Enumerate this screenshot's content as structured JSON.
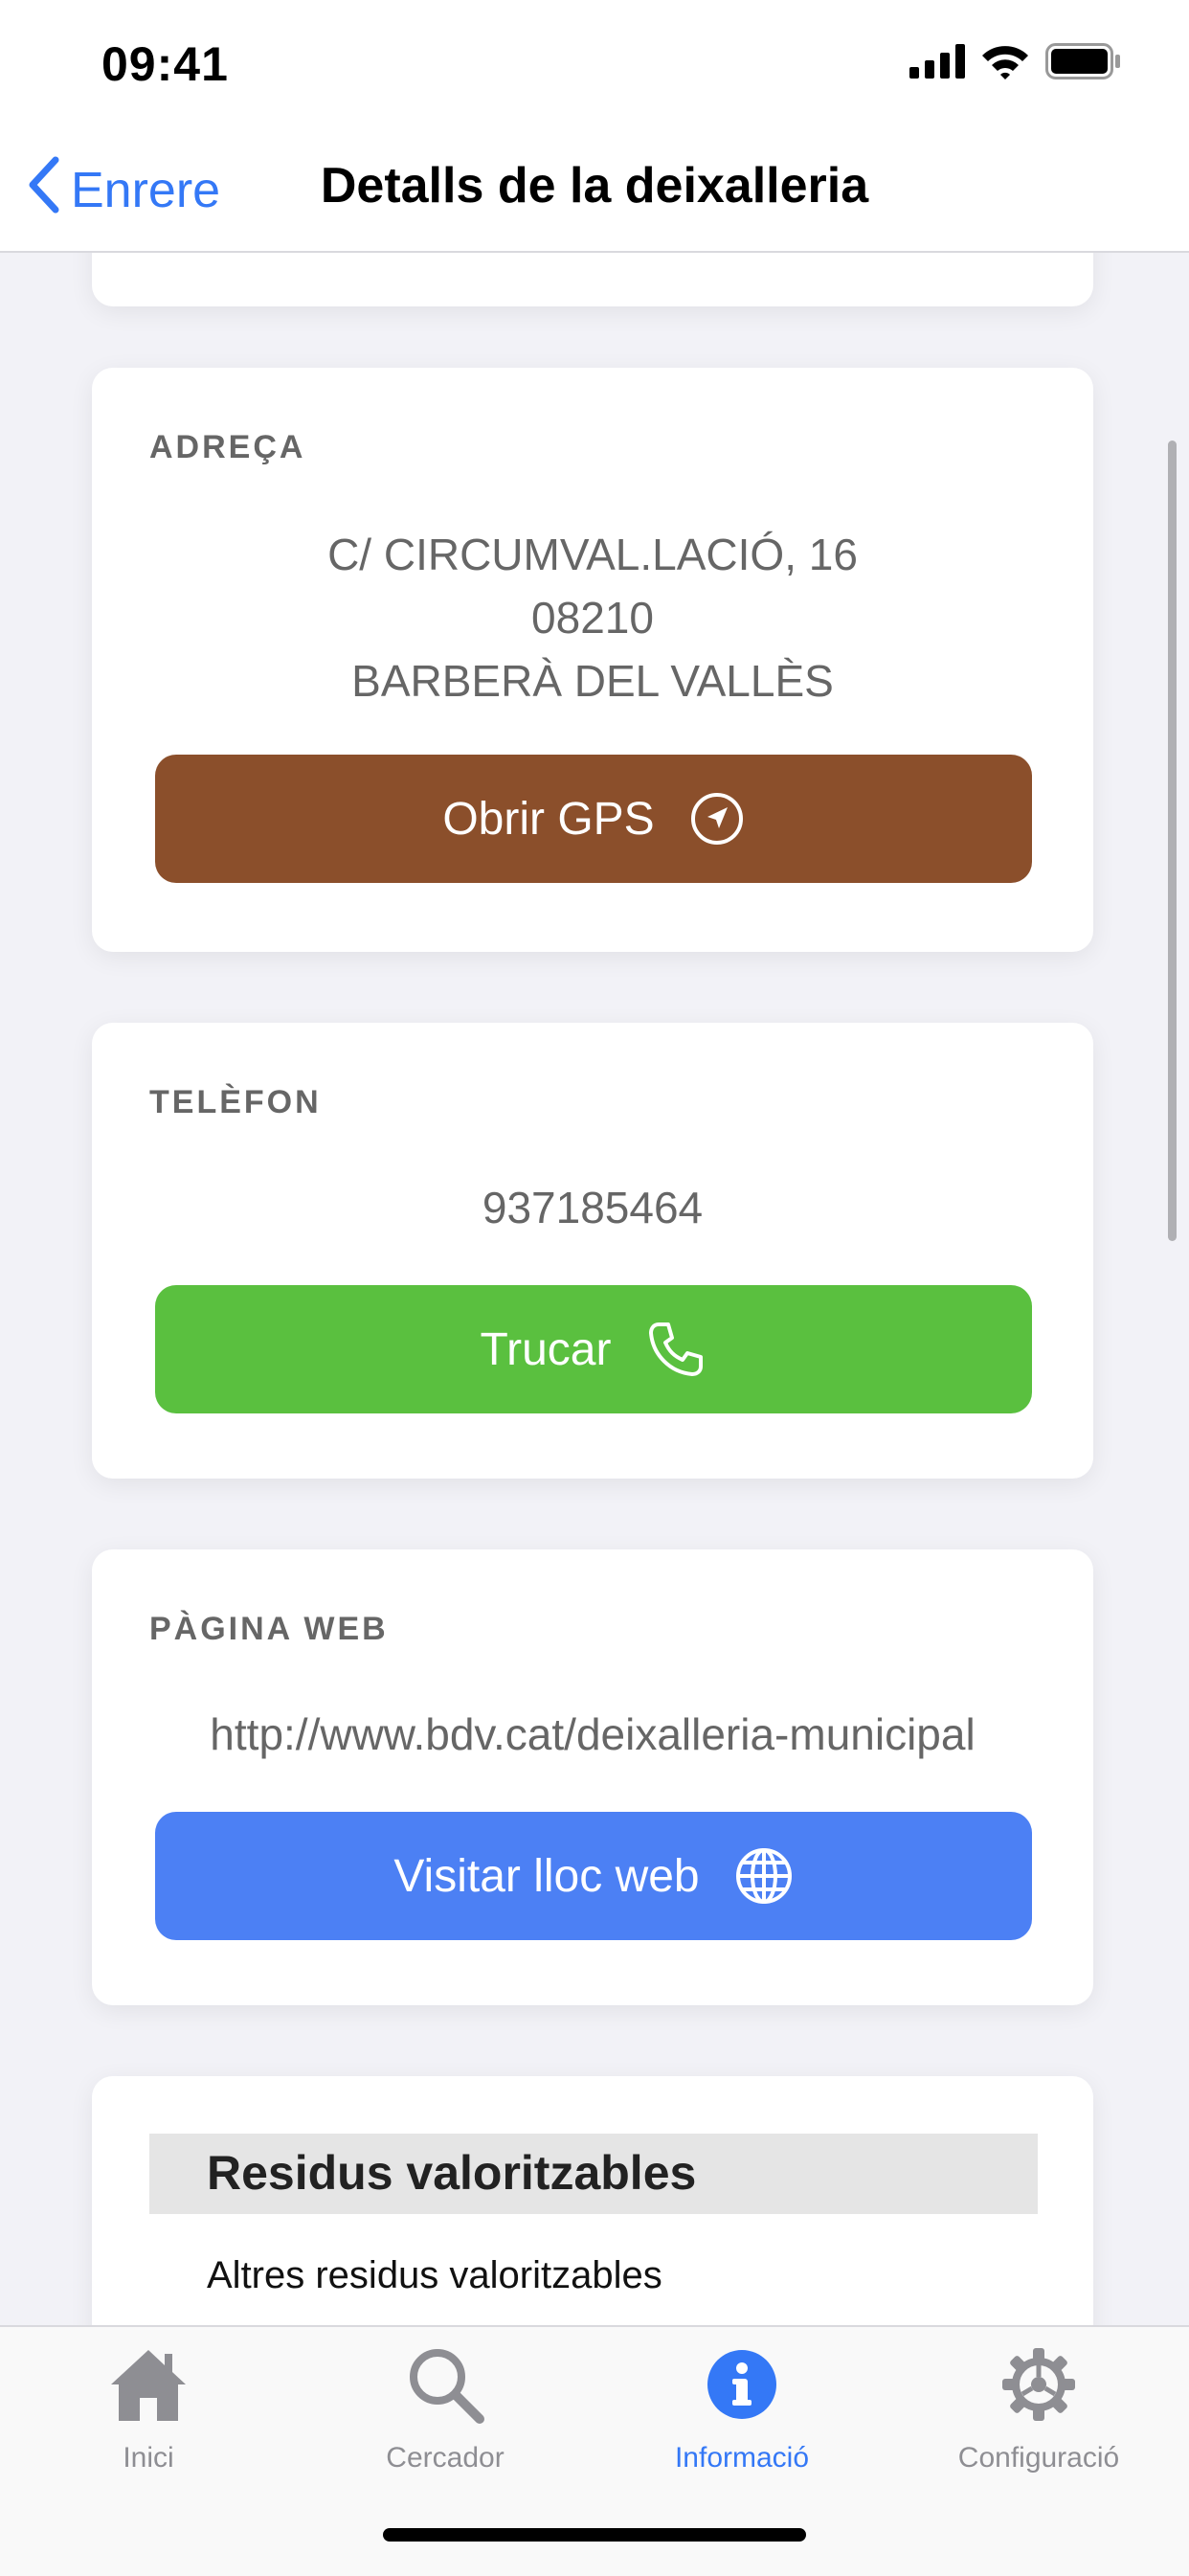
{
  "status_bar": {
    "time": "09:41"
  },
  "nav": {
    "back_label": "Enrere",
    "title": "Detalls de la deixalleria",
    "back_icon": "chevron-left-icon"
  },
  "address_card": {
    "label": "ADREÇA",
    "line1": "C/ CIRCUMVAL.LACIÓ, 16",
    "line2": "08210",
    "line3": "BARBERÀ DEL VALLÈS",
    "button_label": "Obrir GPS",
    "button_icon": "navigation-arrow-icon",
    "button_color": "#8b4f2b"
  },
  "phone_card": {
    "label": "TELÈFON",
    "value": "937185464",
    "button_label": "Trucar",
    "button_icon": "phone-icon",
    "button_color": "#5ac03f"
  },
  "web_card": {
    "label": "PÀGINA WEB",
    "value": "http://www.bdv.cat/deixalleria-municipal",
    "button_label": "Visitar lloc web",
    "button_icon": "globe-icon",
    "button_color": "#4c80f4"
  },
  "waste_card": {
    "section_title": "Residus valoritzables",
    "items": [
      "Altres residus valoritzables"
    ]
  },
  "tabs": [
    {
      "label": "Inici",
      "icon": "home-icon",
      "active": false
    },
    {
      "label": "Cercador",
      "icon": "search-icon",
      "active": false
    },
    {
      "label": "Informació",
      "icon": "info-icon",
      "active": true
    },
    {
      "label": "Configuració",
      "icon": "gear-icon",
      "active": false
    }
  ],
  "colors": {
    "accent": "#3478f6",
    "inactive": "#8e8e93"
  }
}
